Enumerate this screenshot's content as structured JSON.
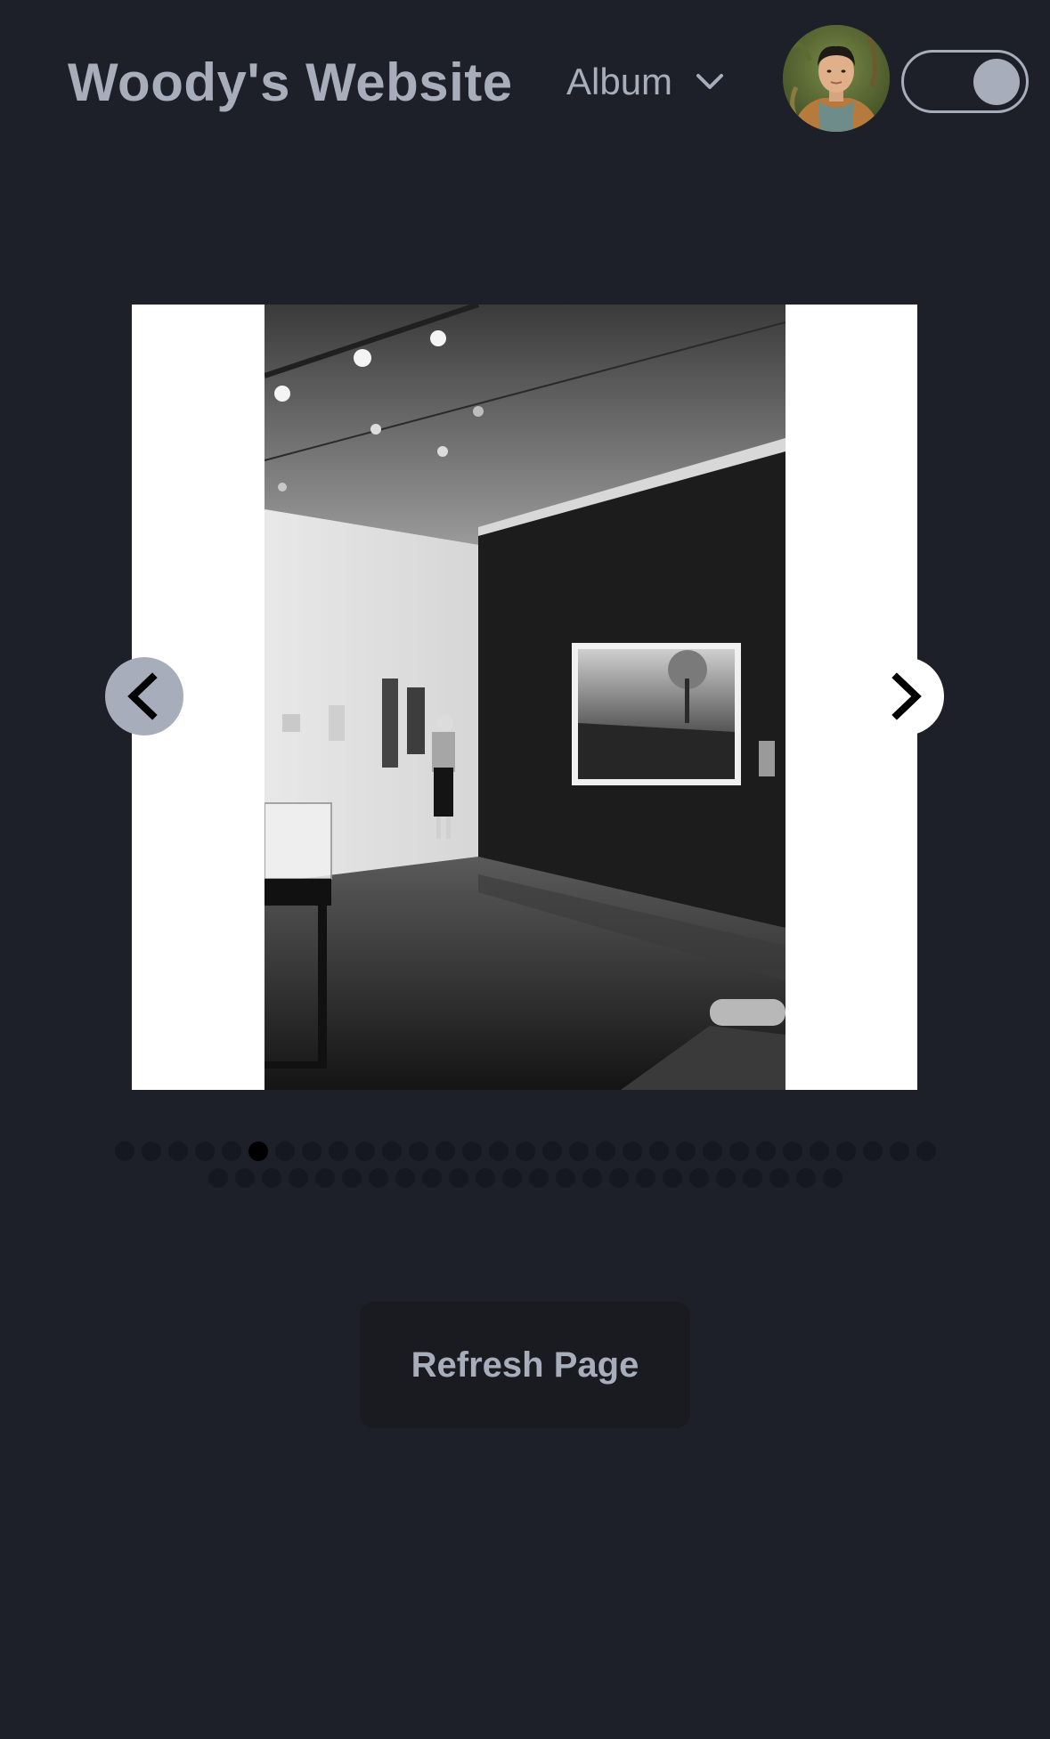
{
  "header": {
    "site_title": "Woody's Website",
    "nav_menu": {
      "label": "Album",
      "icon": "chevron-down-icon"
    },
    "avatar": {
      "icon": "profile-avatar"
    },
    "theme_toggle": {
      "state": "on"
    }
  },
  "carousel": {
    "current_slide_description_icon": "gallery-photo",
    "prev_icon": "chevron-left-icon",
    "next_icon": "chevron-right-icon",
    "total_slides": 55,
    "active_index": 5
  },
  "actions": {
    "refresh_label": "Refresh Page"
  },
  "colors": {
    "background": "#1d2029",
    "text": "#a7adbb",
    "dot": "#151820",
    "dot_active": "#000000",
    "button_bg": "#191b21"
  }
}
